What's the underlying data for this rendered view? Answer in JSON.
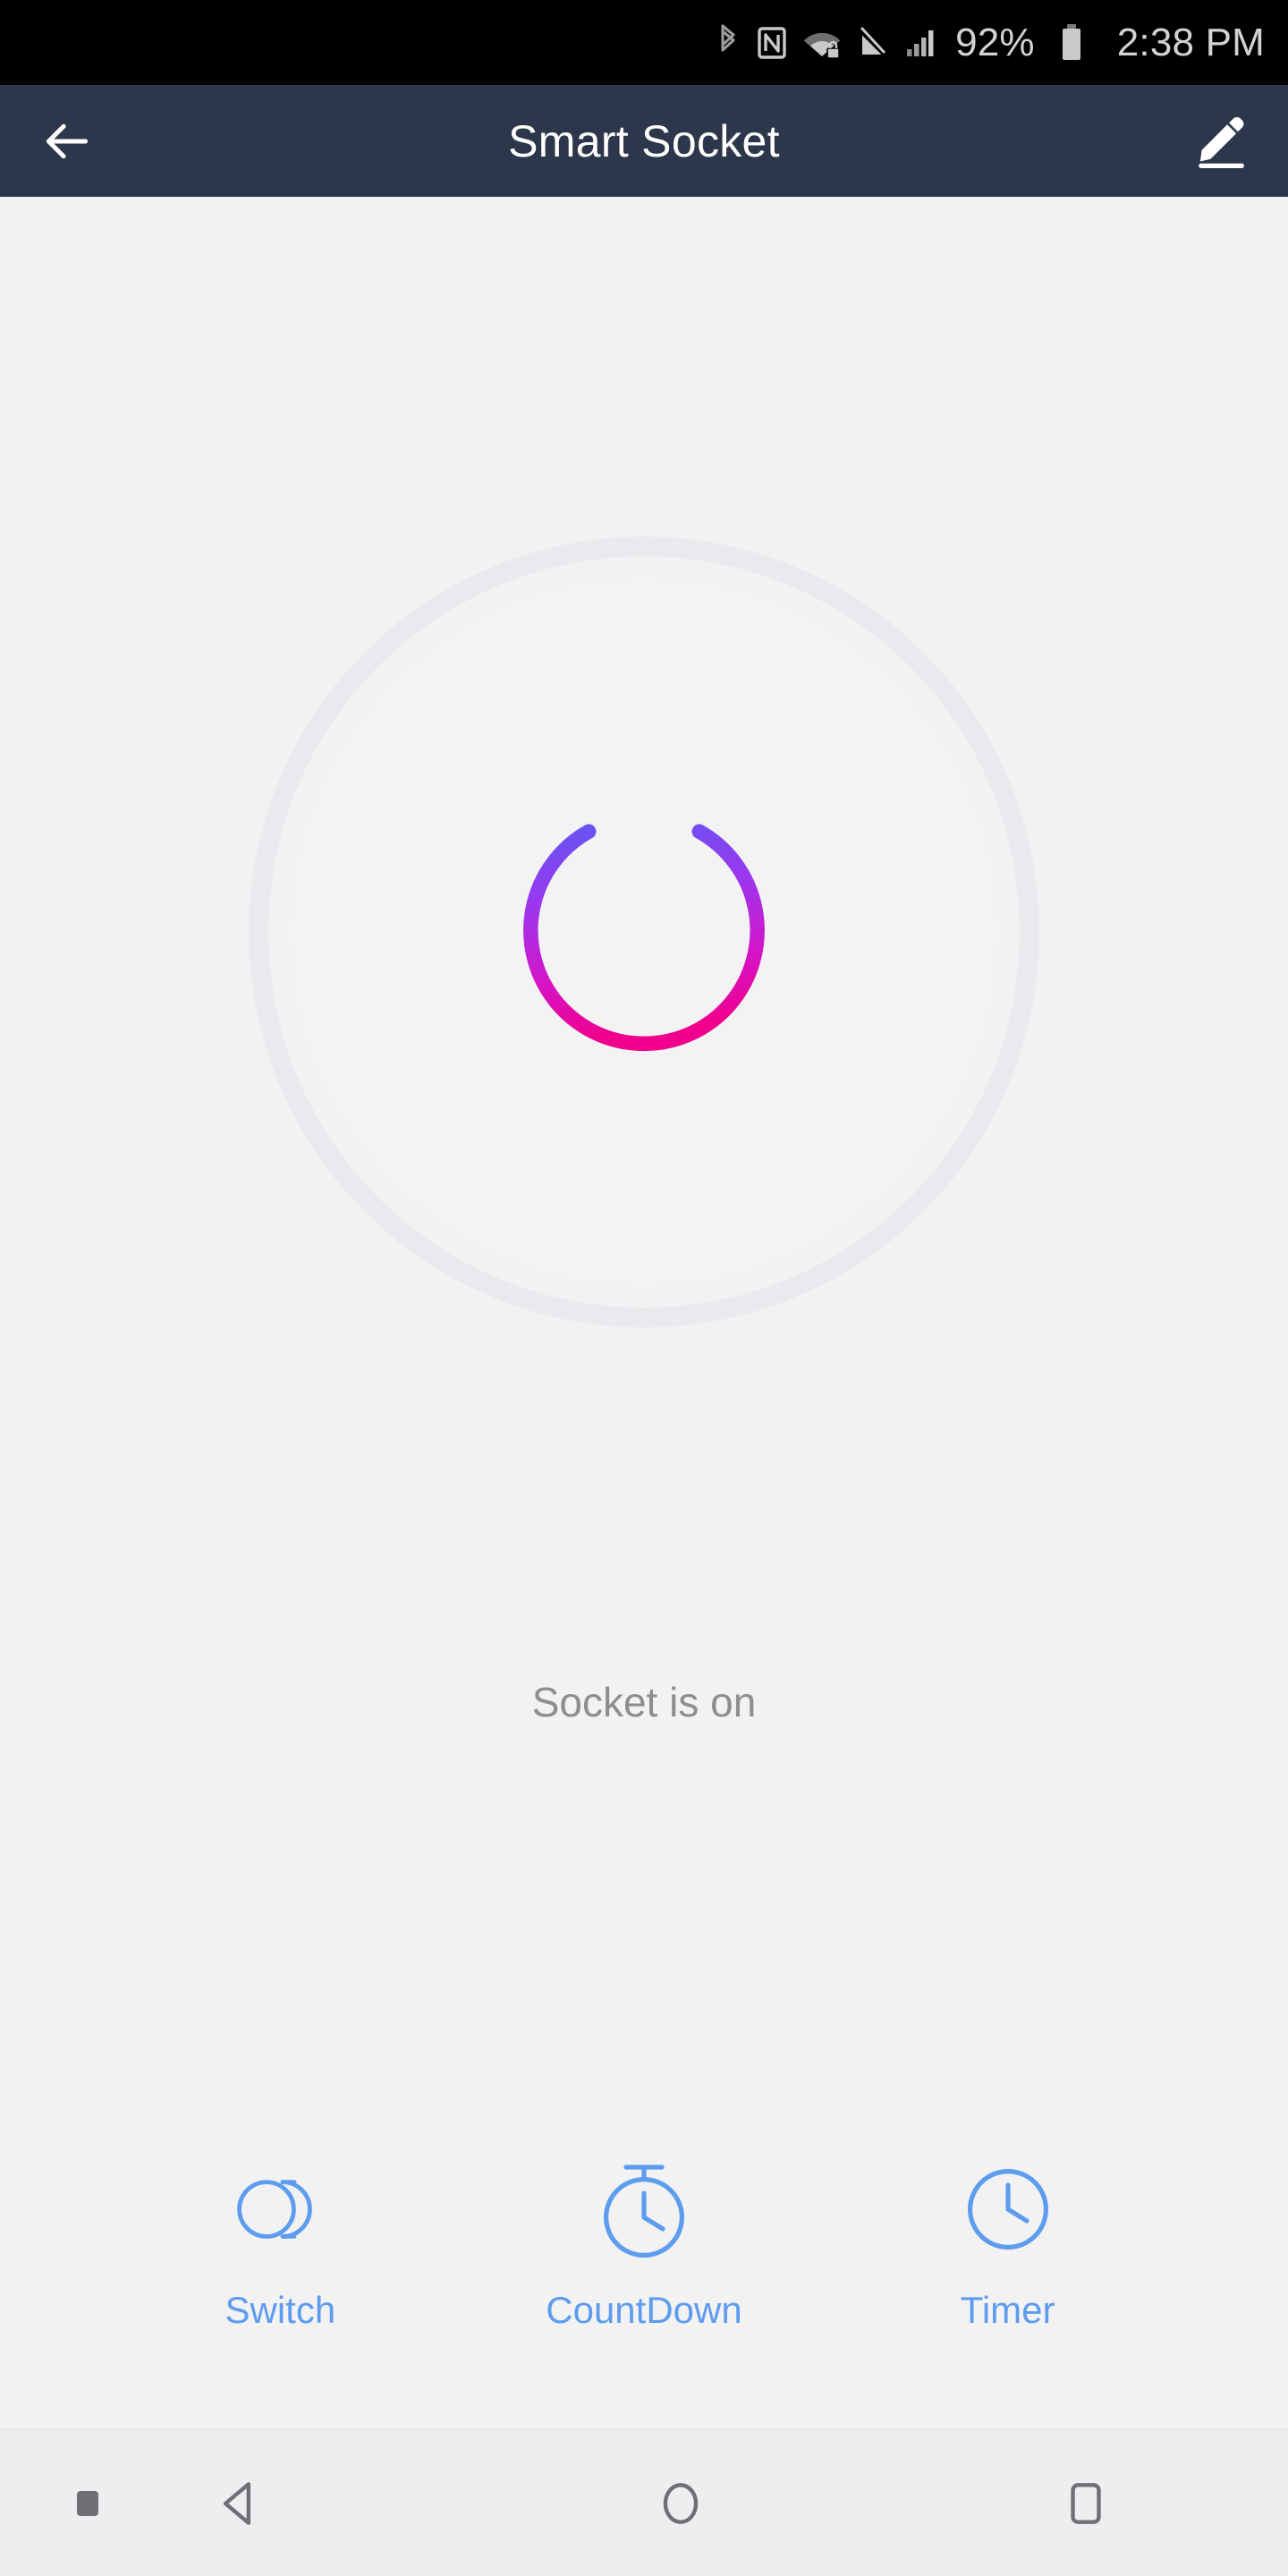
{
  "status_bar": {
    "battery_percent": "92%",
    "time": "2:38 PM",
    "icons": [
      {
        "name": "bluetooth-icon"
      },
      {
        "name": "nfc-icon"
      },
      {
        "name": "wifi-secured-icon"
      },
      {
        "name": "mobile-data-off-icon"
      },
      {
        "name": "cellular-signal-icon"
      },
      {
        "name": "battery-icon"
      }
    ]
  },
  "app_bar": {
    "title": "Smart Socket",
    "back_icon": "arrow-left-icon",
    "edit_icon": "edit-pencil-icon",
    "background": "#2D374B",
    "title_color": "#FFFFFF"
  },
  "power": {
    "icon": "power-icon",
    "state": "on",
    "status_text": "Socket is on",
    "gradient_start": "#6655F2",
    "gradient_end": "#F0008C",
    "ring_color": "#E9EAEE"
  },
  "actions": [
    {
      "label": "Switch",
      "icon": "toggle-switch-icon"
    },
    {
      "label": "CountDown",
      "icon": "stopwatch-icon"
    },
    {
      "label": "Timer",
      "icon": "clock-icon"
    }
  ],
  "action_color": "#5E9CEE",
  "nav_bar": {
    "ime_indicator": "keyboard-indicator-icon",
    "buttons": [
      {
        "name": "back-nav-button",
        "icon": "triangle-back-icon"
      },
      {
        "name": "home-nav-button",
        "icon": "circle-home-icon"
      },
      {
        "name": "recents-nav-button",
        "icon": "square-recents-icon"
      }
    ]
  },
  "background_color": "#F2F2F3"
}
